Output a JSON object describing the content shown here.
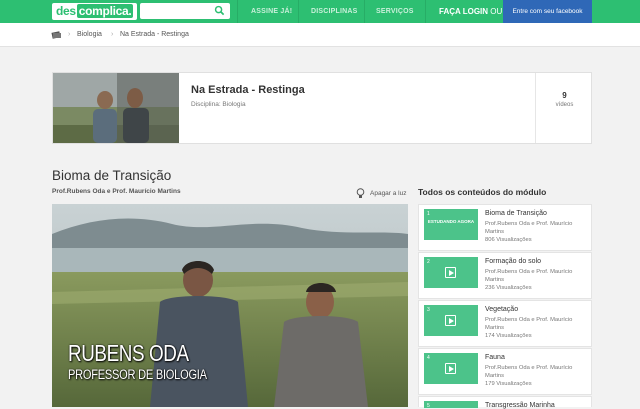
{
  "header": {
    "logo_a": "des",
    "logo_b": "complica.",
    "search_placeholder": "",
    "nav": [
      "ASSINE JÁ!",
      "DISCIPLINAS",
      "SERVIÇOS"
    ],
    "login": "FAÇA LOGIN",
    "login_or": "OU",
    "facebook": "Entre com seu facebook"
  },
  "breadcrumb": [
    "Biologia",
    "Na Estrada - Restinga"
  ],
  "module": {
    "title": "Na Estrada - Restinga",
    "subtitle": "Disciplina: Biologia",
    "video_count": "9",
    "video_label": "vídeos"
  },
  "lesson": {
    "title": "Bioma de Transição",
    "professors": "Prof.Rubens Oda e Prof. Maurício Martins",
    "lights_off": "Apagar a luz",
    "overlay_name": "RUBENS ODA",
    "overlay_role": "PROFESSOR DE BIOLOGIA"
  },
  "sidebar": {
    "heading": "Todos os conteúdos do módulo",
    "items": [
      {
        "num": "1",
        "state": "ESTUDANDO AGORA",
        "title": "Bioma de Transição",
        "profs": "Prof.Rubens Oda e Prof. Maurício Martins",
        "views": "806 Visualizações"
      },
      {
        "num": "2",
        "state": "",
        "title": "Formação do solo",
        "profs": "Prof.Rubens Oda e Prof. Maurício Martins",
        "views": "236 Visualizações"
      },
      {
        "num": "3",
        "state": "",
        "title": "Vegetação",
        "profs": "Prof.Rubens Oda e Prof. Maurício Martins",
        "views": "174 Visualizações"
      },
      {
        "num": "4",
        "state": "",
        "title": "Fauna",
        "profs": "Prof.Rubens Oda e Prof. Maurício Martins",
        "views": "179 Visualizações"
      },
      {
        "num": "5",
        "state": "",
        "title": "Transgressão Marinha",
        "profs": "",
        "views": ""
      }
    ]
  },
  "colors": {
    "brand_green": "#2dbf72",
    "facebook_blue": "#2f68b7",
    "badge_green": "#4cc38a"
  }
}
